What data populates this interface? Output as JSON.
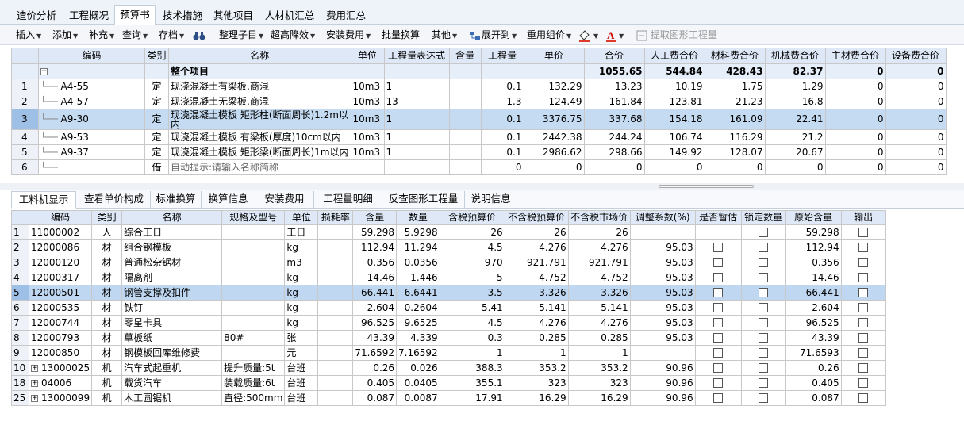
{
  "main_tabs": [
    "造价分析",
    "工程概况",
    "预算书",
    "技术措施",
    "其他项目",
    "人材机汇总",
    "费用汇总"
  ],
  "toolbar": {
    "insert": "插入",
    "add": "添加",
    "supplement": "补充",
    "query": "查询",
    "save": "存档",
    "arrange": "整理子目",
    "height_reduce": "超高降效",
    "install_fee": "安装费用",
    "batch_convert": "批量换算",
    "other": "其他",
    "expand_to": "展开到",
    "reuse_group": "重用组价",
    "extract": "提取图形工程量"
  },
  "top_table": {
    "headers": [
      "编码",
      "类别",
      "名称",
      "单位",
      "工程量表达式",
      "含量",
      "工程量",
      "单价",
      "合价",
      "人工费合价",
      "材料费合价",
      "机械费合价",
      "主材费合价",
      "设备费合价"
    ],
    "summary": {
      "name": "整个项目",
      "total": "1055.65",
      "labor": "544.84",
      "material": "428.43",
      "machine": "82.37",
      "main_mat": "0",
      "equip": "0"
    },
    "rows": [
      {
        "no": "1",
        "code": "A4-55",
        "type": "定",
        "name": "现浇混凝土有梁板,商混",
        "unit": "10m3",
        "expr": "1",
        "content": "",
        "qty": "0.1",
        "price": "132.29",
        "total": "13.23",
        "labor": "10.19",
        "material": "1.75",
        "machine": "1.29",
        "main_mat": "0",
        "equip": "0"
      },
      {
        "no": "2",
        "code": "A4-57",
        "type": "定",
        "name": "现浇混凝土无梁板,商混",
        "unit": "10m3",
        "expr": "13",
        "content": "",
        "qty": "1.3",
        "price": "124.49",
        "total": "161.84",
        "labor": "123.81",
        "material": "21.23",
        "machine": "16.8",
        "main_mat": "0",
        "equip": "0"
      },
      {
        "no": "3",
        "code": "A9-30",
        "type": "定",
        "name": "现浇混凝土模板 矩形柱(断面周长)1.2m以内",
        "unit": "10m3",
        "expr": "1",
        "content": "",
        "qty": "0.1",
        "price": "3376.75",
        "total": "337.68",
        "labor": "154.18",
        "material": "161.09",
        "machine": "22.41",
        "main_mat": "0",
        "equip": "0"
      },
      {
        "no": "4",
        "code": "A9-53",
        "type": "定",
        "name": "现浇混凝土模板 有梁板(厚度)10cm以内",
        "unit": "10m3",
        "expr": "1",
        "content": "",
        "qty": "0.1",
        "price": "2442.38",
        "total": "244.24",
        "labor": "106.74",
        "material": "116.29",
        "machine": "21.2",
        "main_mat": "0",
        "equip": "0"
      },
      {
        "no": "5",
        "code": "A9-37",
        "type": "定",
        "name": "现浇混凝土模板 矩形梁(断面周长)1m以内",
        "unit": "10m3",
        "expr": "1",
        "content": "",
        "qty": "0.1",
        "price": "2986.62",
        "total": "298.66",
        "labor": "149.92",
        "material": "128.07",
        "machine": "20.67",
        "main_mat": "0",
        "equip": "0"
      },
      {
        "no": "6",
        "code": "",
        "type": "借",
        "name": "自动提示:请输入名称简称",
        "unit": "",
        "expr": "",
        "content": "",
        "qty": "0",
        "price": "0",
        "total": "0",
        "labor": "0",
        "material": "0",
        "machine": "0",
        "main_mat": "0",
        "equip": "0"
      }
    ]
  },
  "bottom_tabs": [
    "工料机显示",
    "查看单价构成",
    "标准换算",
    "换算信息",
    "安装费用",
    "工程量明细",
    "反查图形工程量",
    "说明信息"
  ],
  "bottom_table": {
    "headers": [
      "编码",
      "类别",
      "名称",
      "规格及型号",
      "单位",
      "损耗率",
      "含量",
      "数量",
      "含税预算价",
      "不含税预算价",
      "不含税市场价",
      "调整系数(%)",
      "是否暂估",
      "锁定数量",
      "原始含量",
      "输出"
    ],
    "rows": [
      {
        "no": "1",
        "code": "11000002",
        "type": "人",
        "name": "综合工日",
        "spec": "",
        "unit": "工日",
        "loss": "",
        "content": "59.298",
        "qty": "5.9298",
        "tax_price": "26",
        "notax_budget": "26",
        "notax_market": "26",
        "coef": "",
        "est": false,
        "lock": true,
        "orig": "59.298",
        "out": true,
        "plus": false
      },
      {
        "no": "2",
        "code": "12000086",
        "type": "材",
        "name": "组合钢模板",
        "spec": "",
        "unit": "kg",
        "loss": "",
        "content": "112.94",
        "qty": "11.294",
        "tax_price": "4.5",
        "notax_budget": "4.276",
        "notax_market": "4.276",
        "coef": "95.03",
        "est": true,
        "lock": true,
        "orig": "112.94",
        "out": true,
        "plus": false
      },
      {
        "no": "3",
        "code": "12000120",
        "type": "材",
        "name": "普通松杂锯材",
        "spec": "",
        "unit": "m3",
        "loss": "",
        "content": "0.356",
        "qty": "0.0356",
        "tax_price": "970",
        "notax_budget": "921.791",
        "notax_market": "921.791",
        "coef": "95.03",
        "est": true,
        "lock": true,
        "orig": "0.356",
        "out": true,
        "plus": false
      },
      {
        "no": "4",
        "code": "12000317",
        "type": "材",
        "name": "隔离剂",
        "spec": "",
        "unit": "kg",
        "loss": "",
        "content": "14.46",
        "qty": "1.446",
        "tax_price": "5",
        "notax_budget": "4.752",
        "notax_market": "4.752",
        "coef": "95.03",
        "est": true,
        "lock": true,
        "orig": "14.46",
        "out": true,
        "plus": false
      },
      {
        "no": "5",
        "code": "12000501",
        "type": "材",
        "name": "钢管支撑及扣件",
        "spec": "",
        "unit": "kg",
        "loss": "",
        "content": "66.441",
        "qty": "6.6441",
        "tax_price": "3.5",
        "notax_budget": "3.326",
        "notax_market": "3.326",
        "coef": "95.03",
        "est": true,
        "lock": true,
        "orig": "66.441",
        "out": true,
        "plus": false
      },
      {
        "no": "6",
        "code": "12000535",
        "type": "材",
        "name": "铁钉",
        "spec": "",
        "unit": "kg",
        "loss": "",
        "content": "2.604",
        "qty": "0.2604",
        "tax_price": "5.41",
        "notax_budget": "5.141",
        "notax_market": "5.141",
        "coef": "95.03",
        "est": true,
        "lock": true,
        "orig": "2.604",
        "out": true,
        "plus": false
      },
      {
        "no": "7",
        "code": "12000744",
        "type": "材",
        "name": "零星卡具",
        "spec": "",
        "unit": "kg",
        "loss": "",
        "content": "96.525",
        "qty": "9.6525",
        "tax_price": "4.5",
        "notax_budget": "4.276",
        "notax_market": "4.276",
        "coef": "95.03",
        "est": true,
        "lock": true,
        "orig": "96.525",
        "out": true,
        "plus": false
      },
      {
        "no": "8",
        "code": "12000793",
        "type": "材",
        "name": "草板纸",
        "spec": "80#",
        "unit": "张",
        "loss": "",
        "content": "43.39",
        "qty": "4.339",
        "tax_price": "0.3",
        "notax_budget": "0.285",
        "notax_market": "0.285",
        "coef": "95.03",
        "est": true,
        "lock": true,
        "orig": "43.39",
        "out": true,
        "plus": false
      },
      {
        "no": "9",
        "code": "12000850",
        "type": "材",
        "name": "钢模板回库维修费",
        "spec": "",
        "unit": "元",
        "loss": "",
        "content": "71.6592",
        "qty": "7.16592",
        "tax_price": "1",
        "notax_budget": "1",
        "notax_market": "1",
        "coef": "",
        "est": true,
        "lock": true,
        "orig": "71.6593",
        "out": true,
        "plus": false
      },
      {
        "no": "10",
        "code": "13000025",
        "type": "机",
        "name": "汽车式起重机",
        "spec": "提升质量:5t",
        "unit": "台班",
        "loss": "",
        "content": "0.26",
        "qty": "0.026",
        "tax_price": "388.3",
        "notax_budget": "353.2",
        "notax_market": "353.2",
        "coef": "90.96",
        "est": true,
        "lock": true,
        "orig": "0.26",
        "out": true,
        "plus": true
      },
      {
        "no": "18",
        "code": "04006",
        "type": "机",
        "name": "载货汽车",
        "spec": "装载质量:6t",
        "unit": "台班",
        "loss": "",
        "content": "0.405",
        "qty": "0.0405",
        "tax_price": "355.1",
        "notax_budget": "323",
        "notax_market": "323",
        "coef": "90.96",
        "est": true,
        "lock": true,
        "orig": "0.405",
        "out": true,
        "plus": true
      },
      {
        "no": "25",
        "code": "13000099",
        "type": "机",
        "name": "木工圆锯机",
        "spec": "直径:500mm",
        "unit": "台班",
        "loss": "",
        "content": "0.087",
        "qty": "0.0087",
        "tax_price": "17.91",
        "notax_budget": "16.29",
        "notax_market": "16.29",
        "coef": "90.96",
        "est": true,
        "lock": true,
        "orig": "0.087",
        "out": true,
        "plus": true
      }
    ]
  },
  "colors": {
    "header_bg": "#dfe8f7",
    "selected_row": "#c5dbf2",
    "summary_row": "#e6eef9"
  }
}
